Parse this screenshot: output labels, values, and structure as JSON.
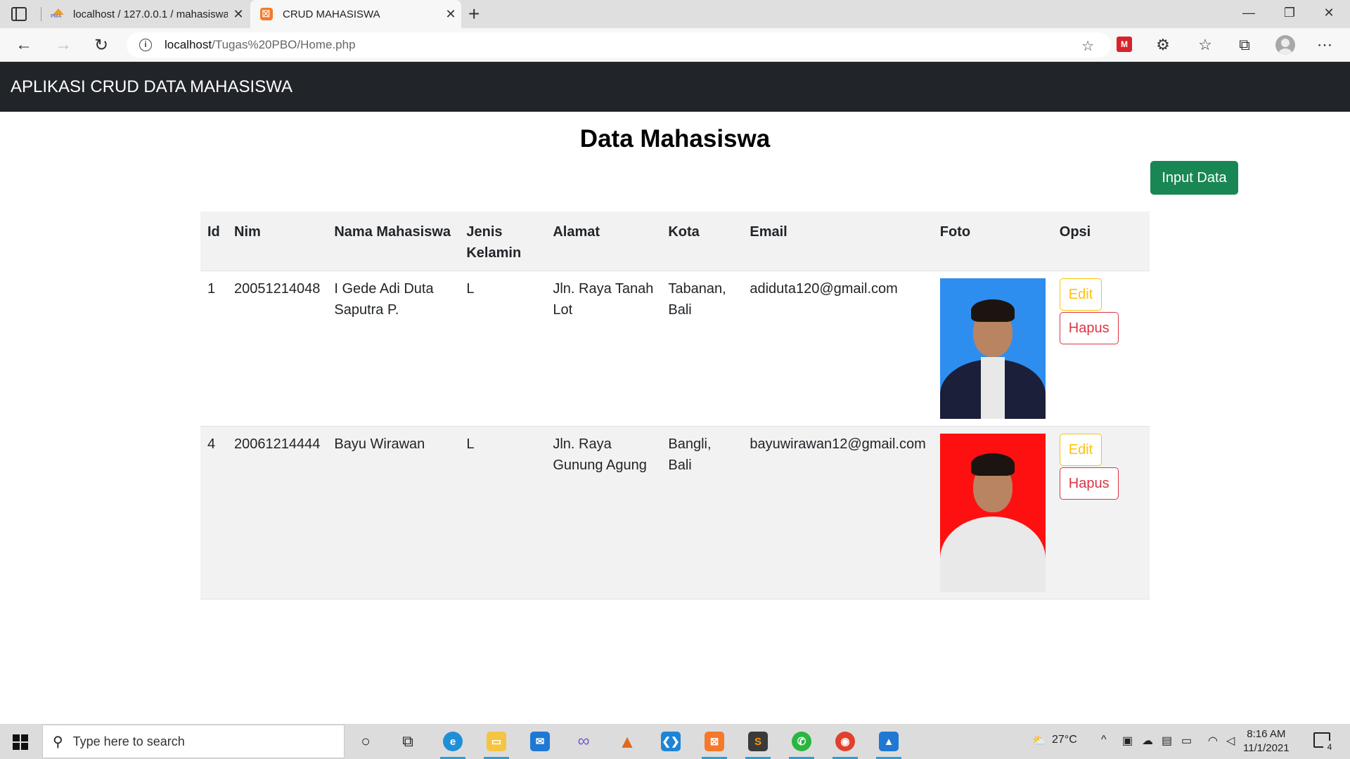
{
  "browser": {
    "tabs": [
      {
        "title": "localhost / 127.0.0.1 / mahasiswa",
        "icon": "phpmyadmin-icon"
      },
      {
        "title": "CRUD MAHASISWA",
        "icon": "xampp-icon"
      }
    ],
    "url_host": "localhost",
    "url_path": "/Tugas%20PBO/Home.php"
  },
  "app": {
    "brand": "APLIKASI CRUD DATA MAHASISWA",
    "title": "Data Mahasiswa",
    "input_button": "Input Data"
  },
  "table": {
    "headers": {
      "id": "Id",
      "nim": "Nim",
      "nama": "Nama Mahasiswa",
      "jk": "Jenis Kelamin",
      "alamat": "Alamat",
      "kota": "Kota",
      "email": "Email",
      "foto": "Foto",
      "opsi": "Opsi"
    },
    "rows": [
      {
        "id": "1",
        "nim": "20051214048",
        "nama": "I Gede Adi Duta Saputra P.",
        "jk": "L",
        "alamat": "Jln. Raya Tanah Lot",
        "kota": "Tabanan, Bali",
        "email": "adiduta120@gmail.com",
        "photo_bg": "#2d8ef0",
        "edit": "Edit",
        "hapus": "Hapus"
      },
      {
        "id": "4",
        "nim": "20061214444",
        "nama": "Bayu Wirawan",
        "jk": "L",
        "alamat": "Jln. Raya Gunung Agung",
        "kota": "Bangli, Bali",
        "email": "bayuwirawan12@gmail.com",
        "photo_bg": "#ff1010",
        "edit": "Edit",
        "hapus": "Hapus"
      }
    ]
  },
  "taskbar": {
    "search_placeholder": "Type here to search",
    "weather": "27°C",
    "time": "8:16 AM",
    "date": "11/1/2021",
    "notification_count": "4"
  },
  "colors": {
    "navbar": "#212529",
    "input_button": "#198754",
    "edit_button": "#ffc107",
    "hapus_button": "#dc3545"
  }
}
